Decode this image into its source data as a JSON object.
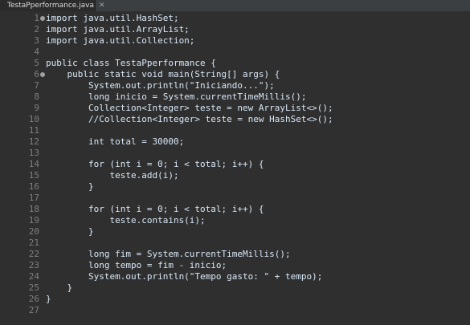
{
  "tab": {
    "title": "TestaPperformance.java",
    "close": "✕"
  },
  "lines": [
    "import java.util.HashSet;",
    "import java.util.ArrayList;",
    "import java.util.Collection;",
    "",
    "public class TestaPperformance {",
    "    public static void main(String[] args) {",
    "        System.out.println(\"Iniciando...\");",
    "        long inicio = System.currentTimeMillis();",
    "        Collection<Integer> teste = new ArrayList<>();",
    "        //Collection<Integer> teste = new HashSet<>();",
    "",
    "        int total = 30000;",
    "",
    "        for (int i = 0; i < total; i++) {",
    "            teste.add(i);",
    "        }",
    "",
    "        for (int i = 0; i < total; i++) {",
    "            teste.contains(i);",
    "        }",
    "",
    "        long fim = System.currentTimeMillis();",
    "        long tempo = fim - inicio;",
    "        System.out.println(\"Tempo gasto: \" + tempo);",
    "    }",
    "}",
    ""
  ]
}
